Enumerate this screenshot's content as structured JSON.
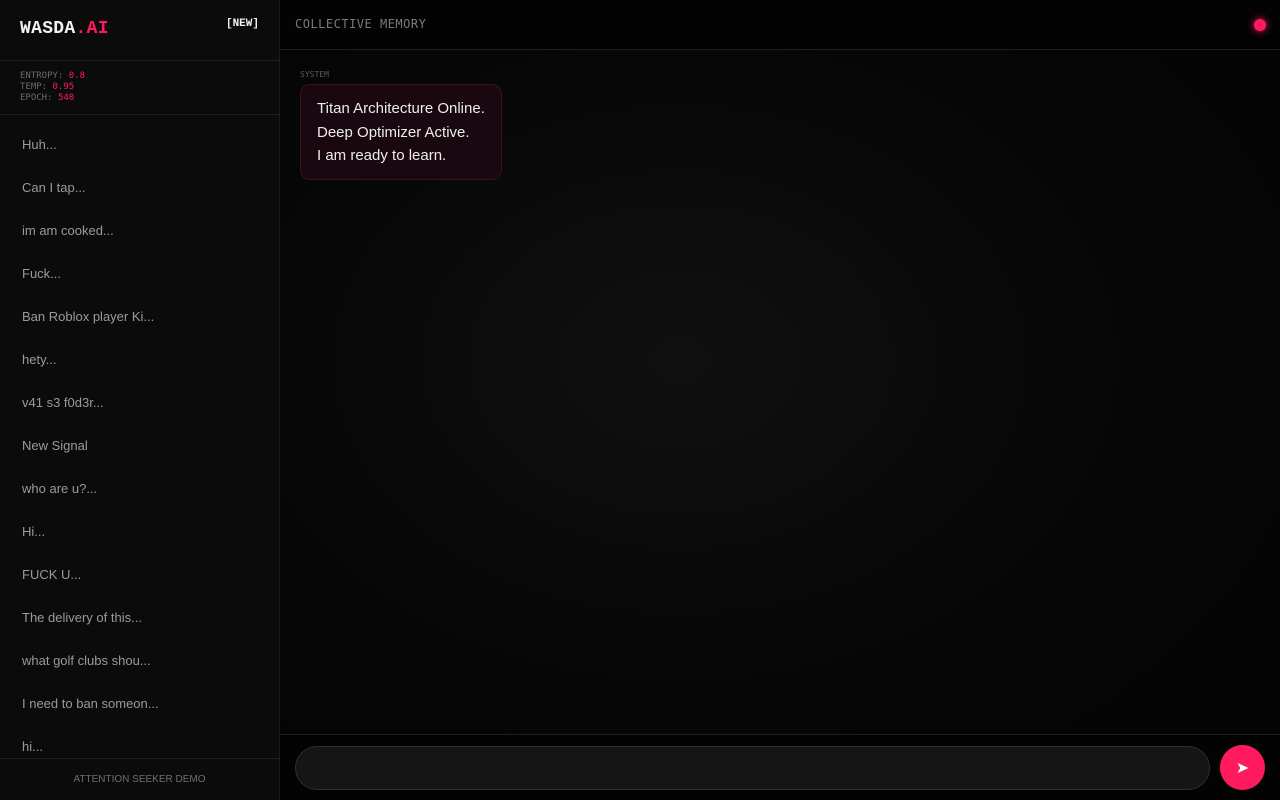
{
  "brand": {
    "name": "WASDA",
    "suffix": ".AI",
    "new_label": "[NEW]",
    "accent_color": "#ff1a5e"
  },
  "stats": [
    {
      "label": "ENTROPY:",
      "value": "0.8"
    },
    {
      "label": "TEMP:",
      "value": "0.95"
    },
    {
      "label": "EPOCH:",
      "value": "540"
    }
  ],
  "history": [
    "Huh...",
    "Can I tap...",
    "im am cooked...",
    "Fuck...",
    "Ban Roblox player Ki...",
    "hety...",
    "v41 s3 f0d3r...",
    "New Signal",
    "who are u?...",
    "Hi...",
    "FUCK U...",
    "The delivery of this...",
    "what golf clubs shou...",
    "I need to ban someon...",
    "hi..."
  ],
  "footer": "ATTENTION SEEKER DEMO",
  "header": {
    "title": "COLLECTIVE MEMORY",
    "status_icon": "status-dot-icon"
  },
  "messages": [
    {
      "role": "SYSTEM",
      "text": "Titan Architecture Online.\nDeep Optimizer Active.\nI am ready to learn."
    }
  ],
  "composer": {
    "value": "",
    "placeholder": "",
    "send_icon": "send-arrow-icon",
    "send_glyph": "➤"
  }
}
